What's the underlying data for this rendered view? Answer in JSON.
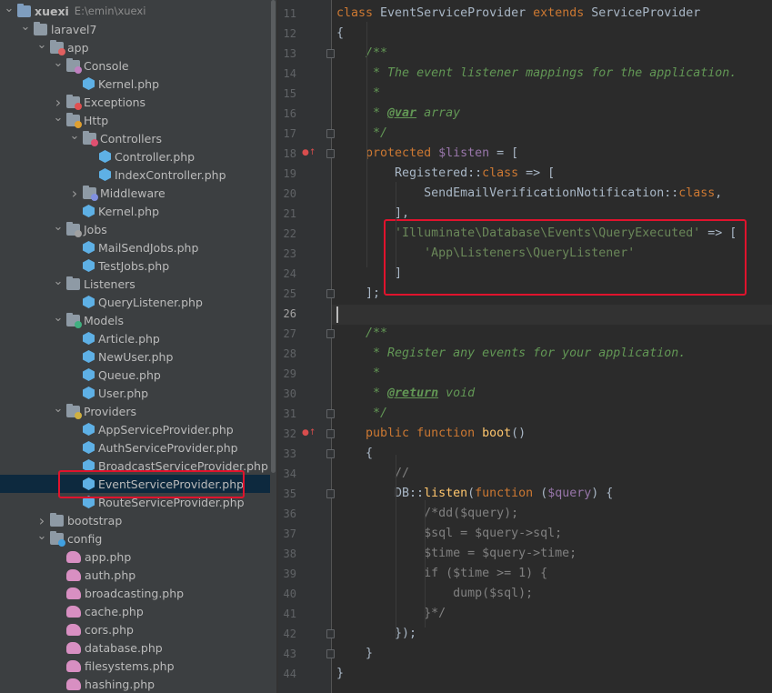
{
  "project_tree": {
    "rows": [
      {
        "label": "xuexi",
        "sub": "E:\\emin\\xuexi",
        "depth": 0,
        "expanded": true,
        "icon": "folder-icon"
      },
      {
        "label": "laravel7",
        "depth": 1,
        "expanded": true,
        "icon": "folder-icon"
      },
      {
        "label": "app",
        "depth": 2,
        "expanded": true,
        "icon": "app-folder-icon"
      },
      {
        "label": "Console",
        "depth": 3,
        "expanded": true,
        "icon": "console-folder-icon"
      },
      {
        "label": "Kernel.php",
        "depth": 4,
        "icon": "php-file-icon"
      },
      {
        "label": "Exceptions",
        "depth": 3,
        "expanded": false,
        "icon": "exceptions-folder-icon"
      },
      {
        "label": "Http",
        "depth": 3,
        "expanded": true,
        "icon": "http-folder-icon"
      },
      {
        "label": "Controllers",
        "depth": 4,
        "expanded": true,
        "icon": "controllers-folder-icon"
      },
      {
        "label": "Controller.php",
        "depth": 5,
        "icon": "php-file-icon"
      },
      {
        "label": "IndexController.php",
        "depth": 5,
        "icon": "php-file-icon"
      },
      {
        "label": "Middleware",
        "depth": 4,
        "expanded": false,
        "icon": "middleware-folder-icon"
      },
      {
        "label": "Kernel.php",
        "depth": 4,
        "icon": "php-file-icon"
      },
      {
        "label": "Jobs",
        "depth": 3,
        "expanded": true,
        "icon": "jobs-folder-icon"
      },
      {
        "label": "MailSendJobs.php",
        "depth": 4,
        "icon": "php-file-icon"
      },
      {
        "label": "TestJobs.php",
        "depth": 4,
        "icon": "php-file-icon"
      },
      {
        "label": "Listeners",
        "depth": 3,
        "expanded": true,
        "icon": "folder-icon"
      },
      {
        "label": "QueryListener.php",
        "depth": 4,
        "icon": "php-file-icon"
      },
      {
        "label": "Models",
        "depth": 3,
        "expanded": true,
        "icon": "models-folder-icon"
      },
      {
        "label": "Article.php",
        "depth": 4,
        "icon": "php-file-icon"
      },
      {
        "label": "NewUser.php",
        "depth": 4,
        "icon": "php-file-icon"
      },
      {
        "label": "Queue.php",
        "depth": 4,
        "icon": "php-file-icon"
      },
      {
        "label": "User.php",
        "depth": 4,
        "icon": "php-file-icon"
      },
      {
        "label": "Providers",
        "depth": 3,
        "expanded": true,
        "icon": "providers-folder-icon"
      },
      {
        "label": "AppServiceProvider.php",
        "depth": 4,
        "icon": "php-file-icon"
      },
      {
        "label": "AuthServiceProvider.php",
        "depth": 4,
        "icon": "php-file-icon"
      },
      {
        "label": "BroadcastServiceProvider.php",
        "depth": 4,
        "icon": "php-file-icon"
      },
      {
        "label": "EventServiceProvider.php",
        "depth": 4,
        "icon": "php-file-icon",
        "selected": true
      },
      {
        "label": "RouteServiceProvider.php",
        "depth": 4,
        "icon": "php-file-icon"
      },
      {
        "label": "bootstrap",
        "depth": 2,
        "expanded": false,
        "icon": "folder-icon"
      },
      {
        "label": "config",
        "depth": 2,
        "expanded": true,
        "icon": "config-folder-icon"
      },
      {
        "label": "app.php",
        "depth": 3,
        "icon": "config-php-icon"
      },
      {
        "label": "auth.php",
        "depth": 3,
        "icon": "config-php-icon"
      },
      {
        "label": "broadcasting.php",
        "depth": 3,
        "icon": "config-php-icon"
      },
      {
        "label": "cache.php",
        "depth": 3,
        "icon": "config-php-icon"
      },
      {
        "label": "cors.php",
        "depth": 3,
        "icon": "config-php-icon"
      },
      {
        "label": "database.php",
        "depth": 3,
        "icon": "config-php-icon"
      },
      {
        "label": "filesystems.php",
        "depth": 3,
        "icon": "config-php-icon"
      },
      {
        "label": "hashing.php",
        "depth": 3,
        "icon": "config-php-icon"
      }
    ]
  },
  "editor": {
    "current_line": 26,
    "lines": [
      {
        "n": 11,
        "tokens": [
          [
            "kw",
            "class "
          ],
          [
            "cls",
            "EventServiceProvider "
          ],
          [
            "kw",
            "extends "
          ],
          [
            "cls",
            "ServiceProvider"
          ]
        ]
      },
      {
        "n": 12,
        "tokens": [
          [
            "cls",
            "{"
          ]
        ]
      },
      {
        "n": 13,
        "tokens": [
          [
            "cls",
            "    "
          ],
          [
            "cmt",
            "/**"
          ]
        ]
      },
      {
        "n": 14,
        "tokens": [
          [
            "cls",
            "     "
          ],
          [
            "cmt",
            "* The event listener mappings for the application."
          ]
        ]
      },
      {
        "n": 15,
        "tokens": [
          [
            "cls",
            "     "
          ],
          [
            "cmt",
            "*"
          ]
        ]
      },
      {
        "n": 16,
        "tokens": [
          [
            "cls",
            "     "
          ],
          [
            "cmt",
            "* "
          ],
          [
            "tag",
            "@var"
          ],
          [
            "cmt",
            " array"
          ]
        ]
      },
      {
        "n": 17,
        "tokens": [
          [
            "cls",
            "     "
          ],
          [
            "cmt",
            "*/"
          ]
        ]
      },
      {
        "n": 18,
        "tokens": [
          [
            "cls",
            "    "
          ],
          [
            "kw",
            "protected "
          ],
          [
            "var",
            "$listen"
          ],
          [
            "cls",
            " = ["
          ]
        ],
        "marker": true
      },
      {
        "n": 19,
        "tokens": [
          [
            "cls",
            "        Registered::"
          ],
          [
            "kw",
            "class"
          ],
          [
            "cls",
            " => ["
          ]
        ]
      },
      {
        "n": 20,
        "tokens": [
          [
            "cls",
            "            SendEmailVerificationNotification::"
          ],
          [
            "kw",
            "class"
          ],
          [
            "cls",
            ","
          ]
        ]
      },
      {
        "n": 21,
        "tokens": [
          [
            "cls",
            "        ],"
          ]
        ]
      },
      {
        "n": 22,
        "tokens": [
          [
            "cls",
            "        "
          ],
          [
            "str",
            "'Illuminate\\Database\\Events\\QueryExecuted'"
          ],
          [
            "cls",
            " => ["
          ]
        ]
      },
      {
        "n": 23,
        "tokens": [
          [
            "cls",
            "            "
          ],
          [
            "str",
            "'App\\Listeners\\QueryListener'"
          ]
        ]
      },
      {
        "n": 24,
        "tokens": [
          [
            "cls",
            "        ]"
          ]
        ]
      },
      {
        "n": 25,
        "tokens": [
          [
            "cls",
            "    ];"
          ]
        ]
      },
      {
        "n": 26,
        "tokens": []
      },
      {
        "n": 27,
        "tokens": [
          [
            "cls",
            "    "
          ],
          [
            "cmt",
            "/**"
          ]
        ]
      },
      {
        "n": 28,
        "tokens": [
          [
            "cls",
            "     "
          ],
          [
            "cmt",
            "* Register any events for your application."
          ]
        ]
      },
      {
        "n": 29,
        "tokens": [
          [
            "cls",
            "     "
          ],
          [
            "cmt",
            "*"
          ]
        ]
      },
      {
        "n": 30,
        "tokens": [
          [
            "cls",
            "     "
          ],
          [
            "cmt",
            "* "
          ],
          [
            "tag",
            "@return"
          ],
          [
            "cmt",
            " void"
          ]
        ]
      },
      {
        "n": 31,
        "tokens": [
          [
            "cls",
            "     "
          ],
          [
            "cmt",
            "*/"
          ]
        ]
      },
      {
        "n": 32,
        "tokens": [
          [
            "cls",
            "    "
          ],
          [
            "kw",
            "public function "
          ],
          [
            "fn",
            "boot"
          ],
          [
            "cls",
            "()"
          ]
        ],
        "marker": true
      },
      {
        "n": 33,
        "tokens": [
          [
            "cls",
            "    {"
          ]
        ]
      },
      {
        "n": 34,
        "tokens": [
          [
            "cls",
            "        "
          ],
          [
            "gray",
            "//"
          ]
        ]
      },
      {
        "n": 35,
        "tokens": [
          [
            "cls",
            "        DB::"
          ],
          [
            "fn",
            "listen"
          ],
          [
            "cls",
            "("
          ],
          [
            "kw",
            "function "
          ],
          [
            "cls",
            "("
          ],
          [
            "var",
            "$query"
          ],
          [
            "cls",
            ") {"
          ]
        ]
      },
      {
        "n": 36,
        "tokens": [
          [
            "cls",
            "            "
          ],
          [
            "gray",
            "/*dd($query);"
          ]
        ]
      },
      {
        "n": 37,
        "tokens": [
          [
            "cls",
            "            "
          ],
          [
            "gray",
            "$sql = $query->sql;"
          ]
        ]
      },
      {
        "n": 38,
        "tokens": [
          [
            "cls",
            "            "
          ],
          [
            "gray",
            "$time = $query->time;"
          ]
        ]
      },
      {
        "n": 39,
        "tokens": [
          [
            "cls",
            "            "
          ],
          [
            "gray",
            "if ($time >= 1) {"
          ]
        ]
      },
      {
        "n": 40,
        "tokens": [
          [
            "cls",
            "                "
          ],
          [
            "gray",
            "dump($sql);"
          ]
        ]
      },
      {
        "n": 41,
        "tokens": [
          [
            "cls",
            "            "
          ],
          [
            "gray",
            "}*/"
          ]
        ]
      },
      {
        "n": 42,
        "tokens": [
          [
            "cls",
            "        });"
          ]
        ]
      },
      {
        "n": 43,
        "tokens": [
          [
            "cls",
            "    }"
          ]
        ]
      },
      {
        "n": 44,
        "tokens": [
          [
            "cls",
            "}"
          ]
        ]
      }
    ]
  }
}
